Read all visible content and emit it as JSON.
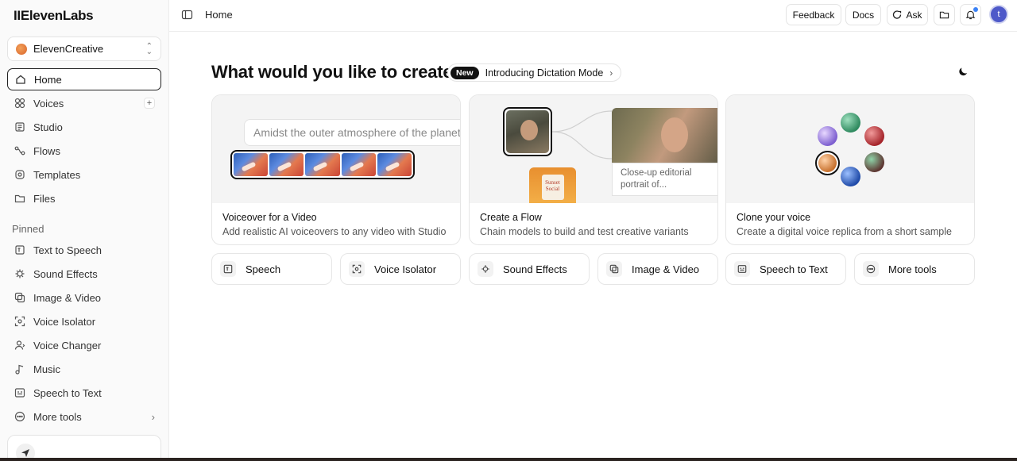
{
  "app": {
    "logo": "IIElevenLabs"
  },
  "workspace": {
    "name": "ElevenCreative"
  },
  "sidebar": {
    "nav": [
      {
        "label": "Home",
        "icon": "home-icon"
      },
      {
        "label": "Voices",
        "icon": "voices-icon"
      },
      {
        "label": "Studio",
        "icon": "studio-icon"
      },
      {
        "label": "Flows",
        "icon": "flows-icon"
      },
      {
        "label": "Templates",
        "icon": "templates-icon"
      },
      {
        "label": "Files",
        "icon": "folder-icon"
      }
    ],
    "pinned_label": "Pinned",
    "pinned": [
      {
        "label": "Text to Speech",
        "icon": "text-to-speech-icon"
      },
      {
        "label": "Sound Effects",
        "icon": "sound-effects-icon"
      },
      {
        "label": "Image & Video",
        "icon": "image-video-icon"
      },
      {
        "label": "Voice Isolator",
        "icon": "voice-isolator-icon"
      },
      {
        "label": "Voice Changer",
        "icon": "voice-changer-icon"
      },
      {
        "label": "Music",
        "icon": "music-icon"
      },
      {
        "label": "Speech to Text",
        "icon": "speech-to-text-icon"
      },
      {
        "label": "More tools",
        "icon": "more-icon"
      }
    ]
  },
  "topbar": {
    "breadcrumb": "Home",
    "feedback": "Feedback",
    "docs": "Docs",
    "ask": "Ask",
    "avatar_letter": "t"
  },
  "main": {
    "headline": "What would you like to create?",
    "announcement": {
      "badge": "New",
      "text": "Introducing Dictation Mode"
    },
    "cards": [
      {
        "title": "Voiceover for a Video",
        "desc": "Add realistic AI voiceovers to any video with Studio",
        "typing": "Amidst the outer atmosphere of the planet"
      },
      {
        "title": "Create a Flow",
        "desc": "Chain models to build and test creative variants",
        "caption": "Close-up editorial portrait of...",
        "can_label": "Sunset Social"
      },
      {
        "title": "Clone your voice",
        "desc": "Create a digital voice replica from a short sample"
      }
    ],
    "tools": [
      {
        "label": "Speech",
        "icon": "speech-icon"
      },
      {
        "label": "Voice Isolator",
        "icon": "voice-isolator-icon"
      },
      {
        "label": "Sound Effects",
        "icon": "sound-effects-icon"
      },
      {
        "label": "Image & Video",
        "icon": "image-video-icon"
      },
      {
        "label": "Speech to Text",
        "icon": "speech-to-text-icon"
      },
      {
        "label": "More tools",
        "icon": "more-icon"
      }
    ]
  },
  "colors": {
    "accent": "#111111",
    "avatar": "#4e59c9",
    "notification": "#3b82f6"
  }
}
